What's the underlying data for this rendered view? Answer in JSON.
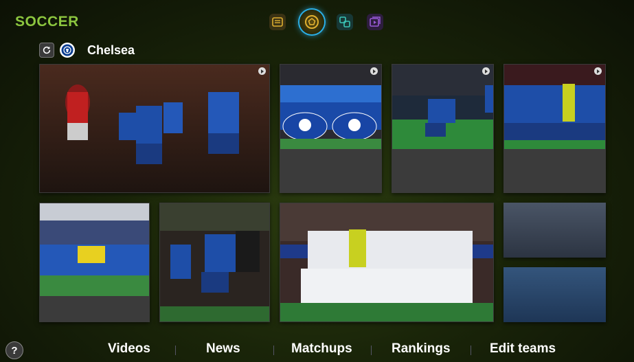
{
  "app": {
    "title": "SOCCER"
  },
  "modes": [
    {
      "name": "news",
      "icon": "news-icon",
      "color": "#e0b030"
    },
    {
      "name": "soccer",
      "icon": "soccer-ball-icon",
      "color": "#e0b030",
      "selected": true
    },
    {
      "name": "social",
      "icon": "social-icon",
      "color": "#3cc6b8"
    },
    {
      "name": "video",
      "icon": "video-icon",
      "color": "#9a5ad8"
    }
  ],
  "team": {
    "name": "Chelsea",
    "refresh_icon": "refresh-icon",
    "crest_icon": "chelsea-crest-icon"
  },
  "tiles": [
    {
      "kind": "video",
      "icon": "play-icon"
    },
    {
      "kind": "video",
      "icon": "play-icon"
    },
    {
      "kind": "video",
      "icon": "play-icon"
    },
    {
      "kind": "video",
      "icon": "play-icon"
    },
    {
      "kind": "photo"
    },
    {
      "kind": "photo"
    },
    {
      "kind": "photo"
    },
    {
      "kind": "empty"
    },
    {
      "kind": "empty"
    }
  ],
  "bottom_nav": {
    "help_label": "?",
    "items": [
      "Videos",
      "News",
      "Matchups",
      "Rankings",
      "Edit teams"
    ]
  },
  "colors": {
    "accent": "#8cc63f",
    "focus": "#2bb0e8"
  }
}
